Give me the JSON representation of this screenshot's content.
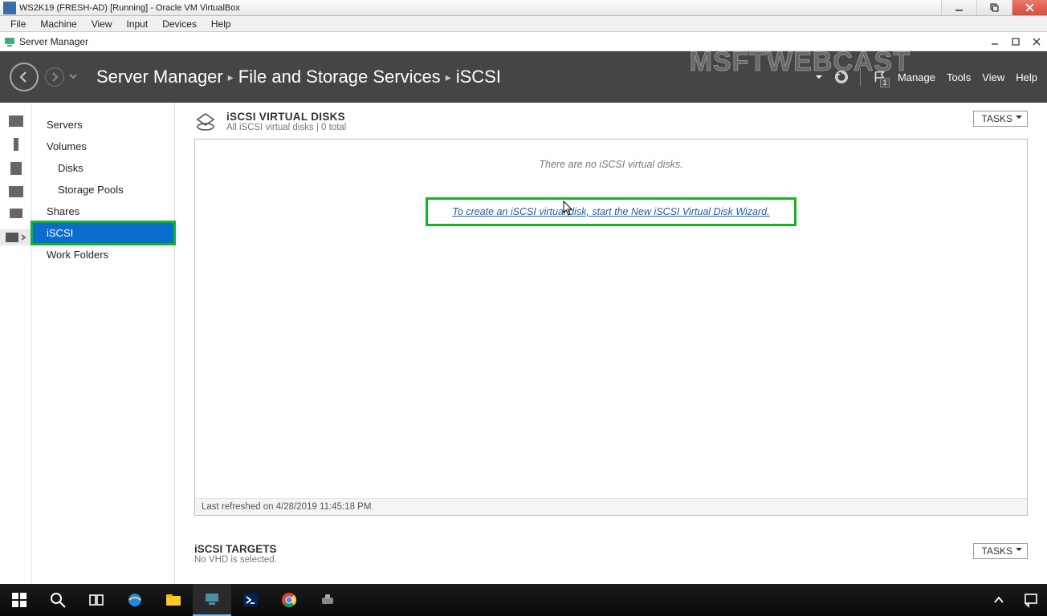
{
  "vbox": {
    "title": "WS2K19 (FRESH-AD) [Running] - Oracle VM VirtualBox",
    "menu": [
      "File",
      "Machine",
      "View",
      "Input",
      "Devices",
      "Help"
    ]
  },
  "sm_window": {
    "title": "Server Manager"
  },
  "header": {
    "crumbs": [
      "Server Manager",
      "File and Storage Services",
      "iSCSI"
    ],
    "menu": [
      "Manage",
      "Tools",
      "View",
      "Help"
    ],
    "notification_count": "1"
  },
  "watermark": "MSFTWEBCAST",
  "sidebar": {
    "items": [
      {
        "label": "Servers",
        "indent": false
      },
      {
        "label": "Volumes",
        "indent": false
      },
      {
        "label": "Disks",
        "indent": true
      },
      {
        "label": "Storage Pools",
        "indent": true
      },
      {
        "label": "Shares",
        "indent": false
      },
      {
        "label": "iSCSI",
        "indent": false,
        "selected": true
      },
      {
        "label": "Work Folders",
        "indent": false
      }
    ]
  },
  "section1": {
    "title": "iSCSI VIRTUAL DISKS",
    "subtitle": "All iSCSI virtual disks | 0 total",
    "tasks_label": "TASKS",
    "empty_msg": "There are no iSCSI virtual disks.",
    "link_text": "To create an iSCSI virtual disk, start the New iSCSI Virtual Disk Wizard.",
    "footer": "Last refreshed on 4/28/2019 11:45:18 PM"
  },
  "section2": {
    "title": "iSCSI TARGETS",
    "subtitle": "No VHD is selected.",
    "tasks_label": "TASKS"
  }
}
